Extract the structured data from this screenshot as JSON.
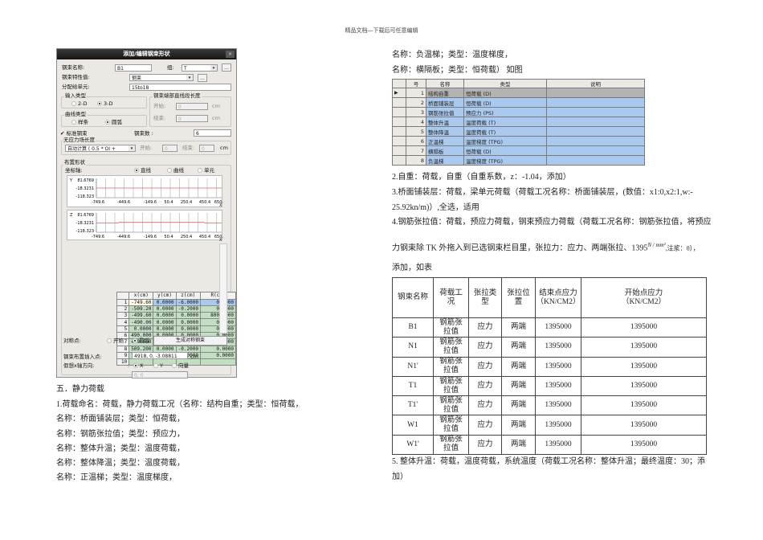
{
  "header": "精品文档---下载后可任意编辑",
  "dialog": {
    "title": "添加/编辑钢束形状",
    "name_label": "钢束名称:",
    "name_value": "B1",
    "group_label": "组:",
    "group_value": "T",
    "prop_label": "钢束特性值:",
    "prop_value": "钢束",
    "assign_label": "分配给单元:",
    "assign_value": "15to18",
    "input_type": "输入类型",
    "r2d": "2-D",
    "r3d": "3-D",
    "curve_type": "曲线类型",
    "spline": "样条",
    "arc": "圆弧",
    "end_len": "钢束端部直线段长度",
    "start": "开始:",
    "end": "结束:",
    "start_val": "0",
    "end_val": "0",
    "cm": "cm",
    "std": "标准钢束",
    "count_label": "钢束数 :",
    "count_value": "6",
    "nostress": "无应力场长度",
    "auto": "自动计算 ( 0.5 * OI +",
    "ns_start": "开始:",
    "ns_end": "结束:",
    "ns_sv": "0",
    "ns_ev": "0",
    "layout": "布置形状",
    "axis": "坐标轴:",
    "line": "直线",
    "curve": "曲线",
    "elem": "单元",
    "chart_y_ticks": [
      "81.6769",
      "-18.3231",
      "-118.323"
    ],
    "chart_x_ticks": [
      "-749.6",
      "-449.6",
      "-149.6",
      "50.4",
      "250.4",
      "450.4",
      "650.4"
    ],
    "chart1_axis": "Y",
    "chart2_axis": "Z",
    "x_axis": "X",
    "geo_headers": [
      "",
      "x(cm)",
      "y(cm)",
      "z(cm)",
      "R(cm)"
    ],
    "geo_rows": [
      [
        "1",
        "-749.60",
        "0.0000",
        "-6.0000",
        "0.0000"
      ],
      [
        "2",
        "-509.20",
        "0.0000",
        "-0.2000",
        "0.0000"
      ],
      [
        "3",
        "-499.60",
        "0.0000",
        "0.0000",
        "800.0000"
      ],
      [
        "4",
        "-490.00",
        "0.0000",
        "0.0000",
        "0.0000"
      ],
      [
        "5",
        "0.0000",
        "0.0000",
        "0.0000",
        "0.0000"
      ],
      [
        "6",
        "490.000",
        "0.0000",
        "0.0000",
        "0.0000"
      ],
      [
        "7",
        "499.600",
        "0.0000",
        "0.0000",
        "800.0000"
      ],
      [
        "8",
        "509.200",
        "0.0000",
        "-0.2000",
        "0.0000"
      ],
      [
        "9",
        "749.600",
        "0.0000",
        "-6.0000",
        "0.0000"
      ],
      [
        "10",
        "",
        "",
        "",
        ""
      ]
    ],
    "sym_label": "对称点:",
    "sym_start": "开始",
    "sym_end": "最后",
    "gen_btn": "生成对称钢束",
    "insert_label": "钢束布置插入点:",
    "insert_value": "4918, 0, -3.08811",
    "xdir_label": "假想x轴方向:",
    "xdir_colon": ":",
    "dx": "X",
    "dy": "Y",
    "dv": "向量",
    "vec_value": "0, 0"
  },
  "left_text": [
    "五．静力荷载",
    "1.荷载命名：荷载，静力荷载工况（名称：结构自重；类型：恒荷载，",
    "名称：桥面铺装层；类型：恒荷载，",
    "名称：钢筋张拉值；类型：预应力，",
    "名称：整体升温；类型：温度荷载，",
    "名称：整体降温；类型：温度荷载，",
    "名称：正温梯；类型：温度梯度，"
  ],
  "right_top": [
    "名称：负温梯；类型：温度梯度，",
    "名称：横隔板；类型：恒荷载） 如图"
  ],
  "load_table": {
    "headers": [
      "",
      "号",
      "名称",
      "类型",
      "说明"
    ],
    "rows": [
      [
        "1",
        "结构自重",
        "恒荷载 (D)",
        ""
      ],
      [
        "2",
        "桥面铺装层",
        "恒荷载 (D)",
        ""
      ],
      [
        "3",
        "钢筋张拉值",
        "预应力 (PS)",
        ""
      ],
      [
        "4",
        "整体升温",
        "温度荷载 (T)",
        ""
      ],
      [
        "5",
        "整体降温",
        "温度荷载 (T)",
        ""
      ],
      [
        "6",
        "正温梯",
        "温度梯度 (TPG)",
        ""
      ],
      [
        "7",
        "横隔板",
        "恒荷载 (D)",
        ""
      ],
      [
        "8",
        "负温梯",
        "温度梯度 (TPG)",
        ""
      ]
    ]
  },
  "right_text": {
    "p2": "2.自重：荷载，自重（自重系数，z：-1.04，添加）",
    "p3a": "3.桥面铺装层：荷载，梁单元荷载（荷载工况名称：桥面铺装层，(数值：x1:0,x2:1,w:-",
    "p3b": "25.92kn/m)）,全选，适用",
    "p4a": "4.钢筋张拉值：荷载，预应力荷载，钢束预应力荷载（荷载工况名称：钢筋张拉值，将预应",
    "p4b": "力钢束除 TK 外拖入到已选钢束栏目里，张拉力：应力、两端张拉、1395",
    "unit": "N / mm²",
    "p4c": ",注浆：0），",
    "p4d": "添加，如表",
    "p5a": "5. 整体升温：荷载，温度荷载，系统温度（荷载工况名称：整体升温；最终温度：30；添",
    "p5b": "加）"
  },
  "tendon_table": {
    "headers": [
      "钢束名称",
      "荷载工\n况",
      "张拉类\n型",
      "张拉位\n置",
      "结束点应力\n（KN/CM2）",
      "开始点应力\n（KN/CM2）"
    ],
    "rows": [
      [
        "B1",
        "钢筋张\n拉值",
        "应力",
        "两端",
        "1395000",
        "1395000"
      ],
      [
        "N1",
        "钢筋张\n拉值",
        "应力",
        "两端",
        "1395000",
        "1395000"
      ],
      [
        "N1'",
        "钢筋张\n拉值",
        "应力",
        "两端",
        "1395000",
        "1395000"
      ],
      [
        "T1",
        "钢筋张\n拉值",
        "应力",
        "两端",
        "1395000",
        "1395000"
      ],
      [
        "T1'",
        "钢筋张\n拉值",
        "应力",
        "两端",
        "1395000",
        "1395000"
      ],
      [
        "W1",
        "钢筋张\n拉值",
        "应力",
        "两端",
        "1395000",
        "1395000"
      ],
      [
        "W1'",
        "钢筋张\n拉值",
        "应力",
        "两端",
        "1395000",
        "1395000"
      ]
    ]
  }
}
